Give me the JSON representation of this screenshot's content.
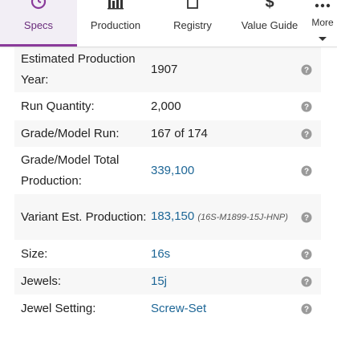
{
  "tabs": [
    {
      "label": "Specs",
      "icon": "clock-icon",
      "active": true
    },
    {
      "label": "Production",
      "icon": "bar-chart-icon",
      "active": false
    },
    {
      "label": "Registry",
      "icon": "document-icon",
      "active": false
    },
    {
      "label": "Value Guide",
      "icon": "dollar-icon",
      "active": false
    },
    {
      "label": "More",
      "icon": "more-dots-icon",
      "active": false
    }
  ],
  "specs": {
    "rows": [
      {
        "label": "Estimated Production Year:",
        "value": "1907"
      },
      {
        "label": "Run Quantity:",
        "value": "2,000"
      },
      {
        "label": "Grade/Model Run:",
        "value": "167 of 174"
      },
      {
        "label": "Grade/Model Total Production:",
        "value": "339,100"
      },
      {
        "label": "Variant Est. Production:",
        "value": "183,150",
        "note": "(16S-M1899-15J-HNP)"
      },
      {
        "label": "Size:",
        "value": "16s"
      },
      {
        "label": "Jewels:",
        "value": "15j"
      },
      {
        "label": "Jewel Setting:",
        "value": "Screw-Set"
      }
    ]
  },
  "colors": {
    "accent": "#8a3a9a",
    "link": "#1d6696",
    "stripe": "#f7f7f7",
    "help_icon": "#9a9a9a"
  }
}
